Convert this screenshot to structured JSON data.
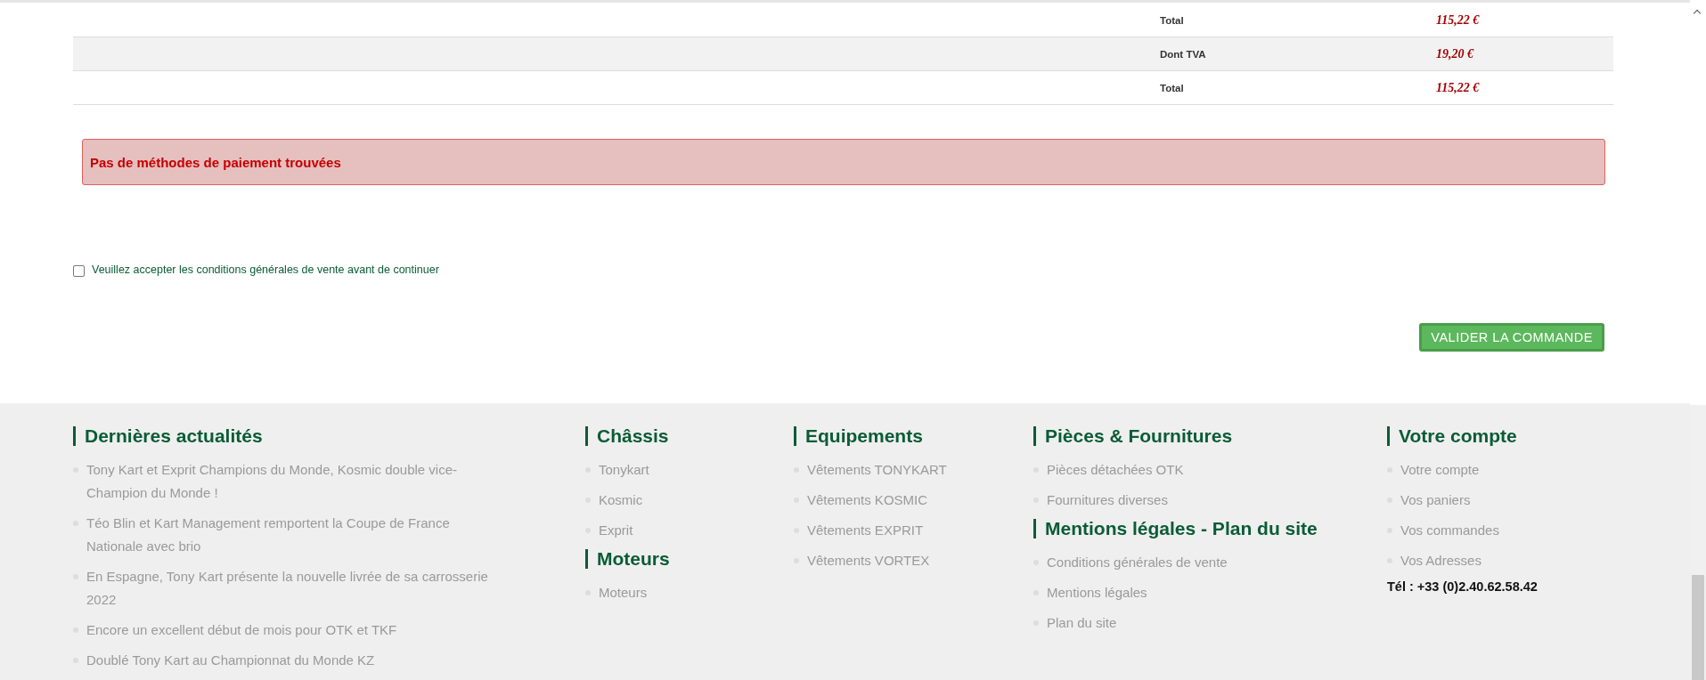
{
  "totals": [
    {
      "label": "Total",
      "value": "115,22 €",
      "shaded": false
    },
    {
      "label": "Dont TVA",
      "value": "19,20 €",
      "shaded": true
    },
    {
      "label": "Total",
      "value": "115,22 €",
      "shaded": false
    }
  ],
  "alert": {
    "text": "Pas de méthodes de paiement trouvées"
  },
  "terms": {
    "label": "Veuillez accepter les conditions générales de vente avant de continuer",
    "checked": false
  },
  "submit_button": "VALIDER LA COMMANDE",
  "footer": {
    "columns": [
      {
        "sections": [
          {
            "title": "Dernières actualités",
            "items": [
              "Tony Kart et Exprit Champions du Monde, Kosmic double vice-Champion du Monde !",
              "Téo Blin et Kart Management remportent la Coupe de France Nationale avec brio",
              "En Espagne, Tony Kart présente la nouvelle livrée de sa carrosserie 2022",
              "Encore un excellent début de mois pour OTK et TKF",
              "Doublé Tony Kart au Championnat du Monde KZ"
            ]
          }
        ]
      },
      {
        "sections": [
          {
            "title": "Châssis",
            "items": [
              "Tonykart",
              "Kosmic",
              "Exprit"
            ]
          },
          {
            "title": "Moteurs",
            "items": [
              "Moteurs"
            ]
          }
        ]
      },
      {
        "sections": [
          {
            "title": "Equipements",
            "items": [
              "Vêtements TONYKART",
              "Vêtements KOSMIC",
              "Vêtements EXPRIT",
              "Vêtements VORTEX"
            ]
          }
        ]
      },
      {
        "sections": [
          {
            "title": "Pièces & Fournitures",
            "items": [
              "Pièces détachées OTK",
              "Fournitures diverses"
            ]
          },
          {
            "title": "Mentions légales - Plan du site",
            "items": [
              "Conditions générales de vente",
              "Mentions légales",
              "Plan du site"
            ]
          }
        ]
      },
      {
        "sections": [
          {
            "title": "Votre compte",
            "items": [
              "Votre compte",
              "Vos paniers",
              "Vos commandes",
              "Vos Adresses"
            ]
          }
        ],
        "phone": "Tél : +33 (0)2.40.62.58.42"
      }
    ]
  }
}
